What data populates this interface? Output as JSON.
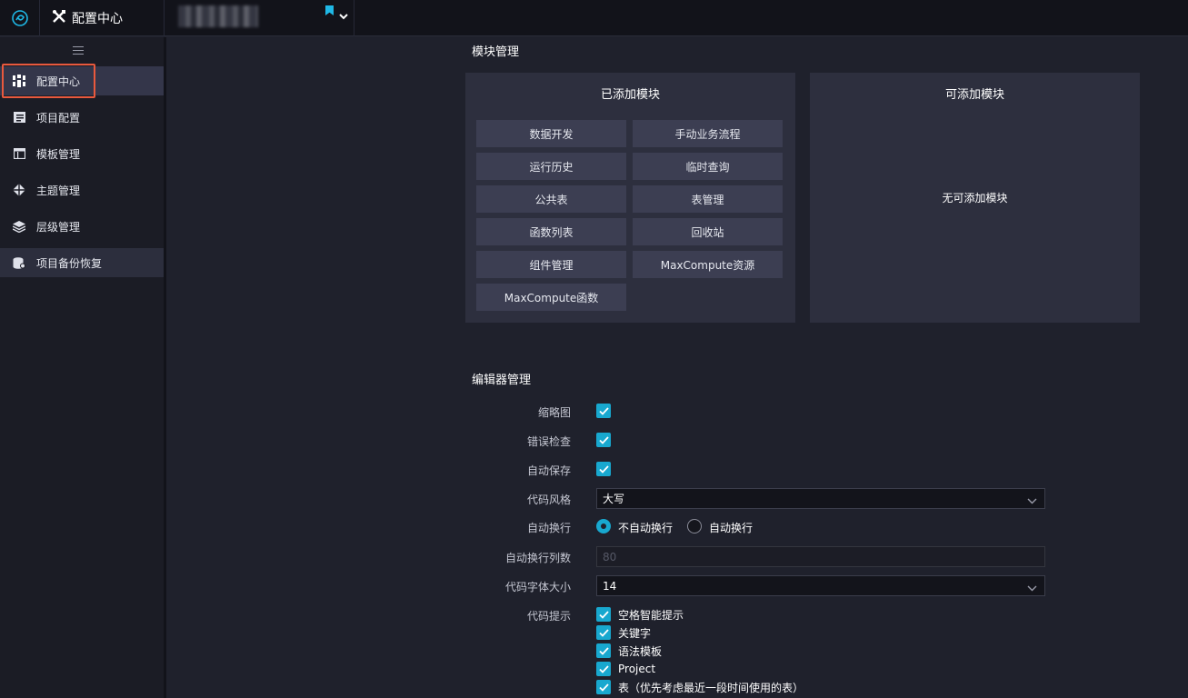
{
  "header": {
    "app_title": "配置中心"
  },
  "sidebar": {
    "items": [
      {
        "label": "配置中心",
        "icon": "config-grid-icon"
      },
      {
        "label": "项目配置",
        "icon": "folder-doc-icon"
      },
      {
        "label": "模板管理",
        "icon": "template-icon"
      },
      {
        "label": "主题管理",
        "icon": "theme-icon"
      },
      {
        "label": "层级管理",
        "icon": "layers-icon"
      },
      {
        "label": "项目备份恢复",
        "icon": "backup-icon"
      }
    ]
  },
  "module_section": {
    "title": "模块管理",
    "added_title": "已添加模块",
    "added_modules": [
      "数据开发",
      "手动业务流程",
      "运行历史",
      "临时查询",
      "公共表",
      "表管理",
      "函数列表",
      "回收站",
      "组件管理",
      "MaxCompute资源",
      "MaxCompute函数"
    ],
    "available_title": "可添加模块",
    "available_empty": "无可添加模块"
  },
  "editor_section": {
    "title": "编辑器管理",
    "minimap_label": "缩略图",
    "error_check_label": "错误检查",
    "autosave_label": "自动保存",
    "code_style_label": "代码风格",
    "code_style_value": "大写",
    "word_wrap_label": "自动换行",
    "wrap_options": [
      "不自动换行",
      "自动换行"
    ],
    "wrap_columns_label": "自动换行列数",
    "wrap_columns_value": "80",
    "font_size_label": "代码字体大小",
    "font_size_value": "14",
    "hints_label": "代码提示",
    "hints": [
      "空格智能提示",
      "关键字",
      "语法模板",
      "Project",
      "表（优先考虑最近一段时间使用的表）"
    ]
  },
  "colors": {
    "accent": "#18a8cf",
    "highlight_border": "#e9593d",
    "background": "#1f212c",
    "panel": "#2d2f3e"
  }
}
